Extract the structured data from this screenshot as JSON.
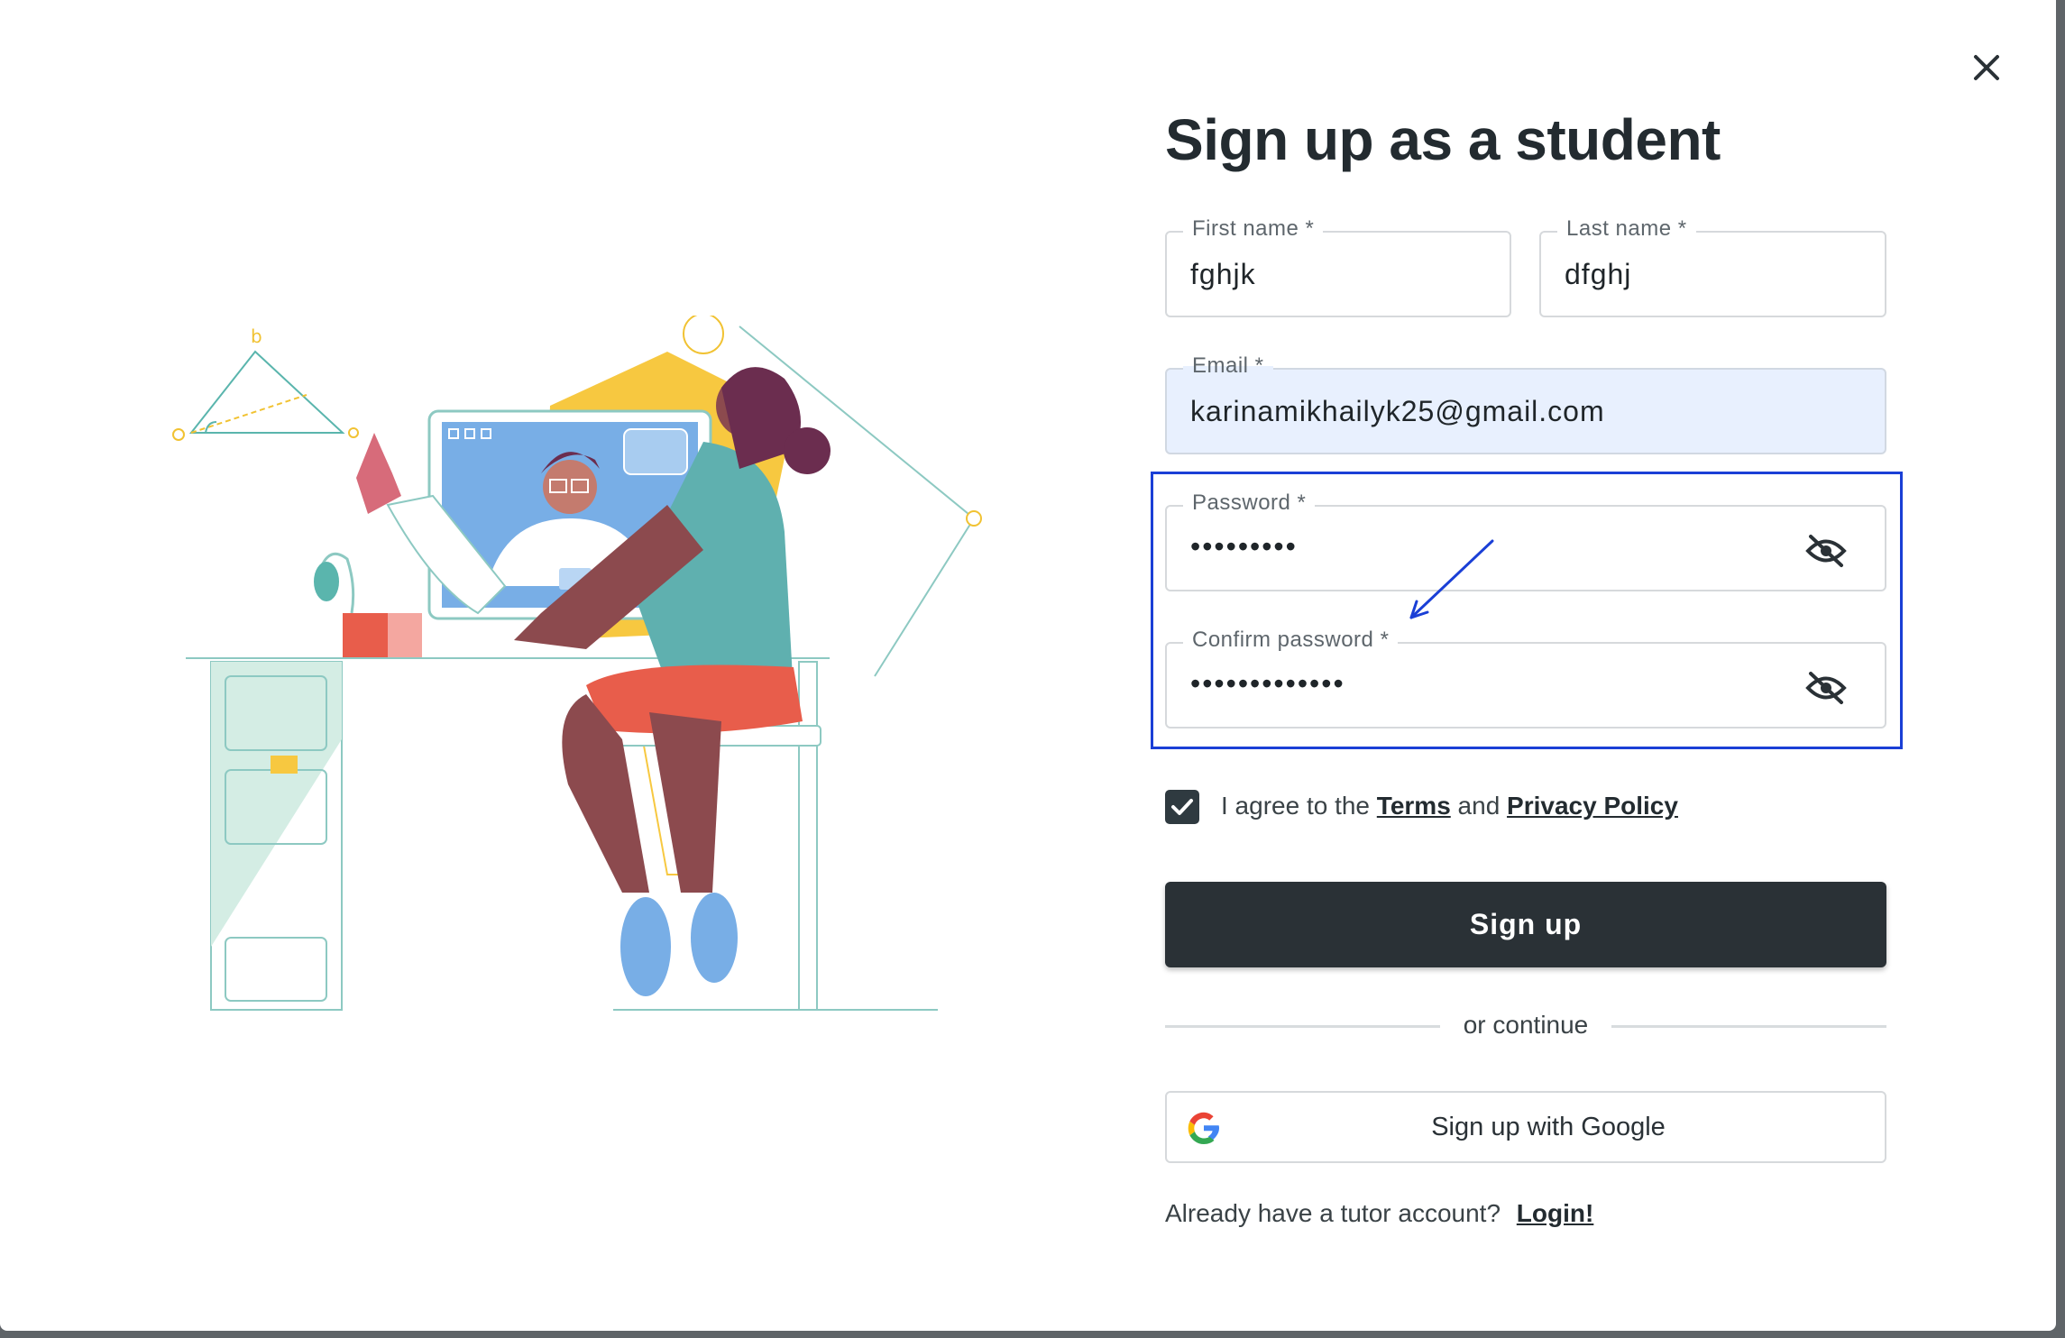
{
  "dialog": {
    "title": "Sign up as a student",
    "close_icon": "close-icon"
  },
  "fields": {
    "first_name": {
      "label": "First name *",
      "value": "fghjk"
    },
    "last_name": {
      "label": "Last name *",
      "value": "dfghj"
    },
    "email": {
      "label": "Email *",
      "value": "karinamikhailyk25@gmail.com"
    },
    "password": {
      "label": "Password *",
      "value": "•••••••••",
      "toggle_icon": "eye-off-icon"
    },
    "confirm_password": {
      "label": "Confirm password *",
      "value": "•••••••••••••",
      "toggle_icon": "eye-off-icon"
    }
  },
  "agreement": {
    "checked": true,
    "prefix": "I agree to the",
    "terms": "Terms",
    "and": "and",
    "privacy": "Privacy Policy"
  },
  "actions": {
    "signup_label": "Sign up",
    "divider_text": "or continue",
    "google_label": "Sign up with Google",
    "google_icon": "google-icon"
  },
  "footer": {
    "question": "Already have a tutor account?",
    "login_link": "Login!"
  },
  "colors": {
    "primary_button": "#2a3136",
    "autofill_bg": "#e8f0fe",
    "annotation_blue": "#1a3fd6"
  }
}
